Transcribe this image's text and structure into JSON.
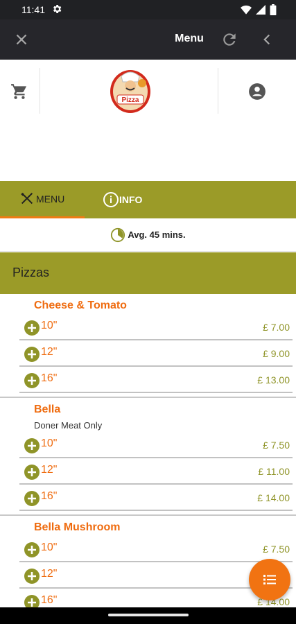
{
  "status_bar": {
    "time": "11:41"
  },
  "app_bar": {
    "title": "Menu"
  },
  "tabs": [
    {
      "label": "MENU",
      "icon": "cutlery-icon",
      "active": true
    },
    {
      "label": "INFO",
      "icon": "info-icon",
      "active": false
    }
  ],
  "delivery": {
    "text": "Avg. 45 mins.",
    "icon": "timer-icon"
  },
  "logo": {
    "text": "Pizza"
  },
  "category": {
    "name": "Pizzas"
  },
  "colors": {
    "accent_olive": "#9b9b28",
    "accent_orange": "#f07c13",
    "appbar_dark": "#26262b"
  },
  "products": [
    {
      "name": "Cheese & Tomato",
      "description": "",
      "options": [
        {
          "size": "10\"",
          "price": "£ 7.00"
        },
        {
          "size": "12\"",
          "price": "£ 9.00"
        },
        {
          "size": "16\"",
          "price": "£ 13.00"
        }
      ]
    },
    {
      "name": "Bella",
      "description": "Doner Meat Only",
      "options": [
        {
          "size": "10\"",
          "price": "£ 7.50"
        },
        {
          "size": "12\"",
          "price": "£ 11.00"
        },
        {
          "size": "16\"",
          "price": "£ 14.00"
        }
      ]
    },
    {
      "name": "Bella Mushroom",
      "description": "",
      "options": [
        {
          "size": "10\"",
          "price": "£ 7.50"
        },
        {
          "size": "12\"",
          "price": ""
        },
        {
          "size": "16\"",
          "price": "£ 14.00"
        }
      ]
    }
  ]
}
